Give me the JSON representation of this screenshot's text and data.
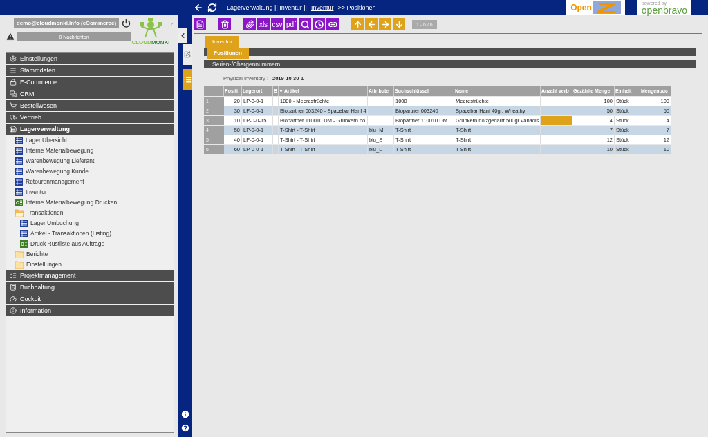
{
  "header": {
    "breadcrumb": [
      {
        "text": "Lagerverwaltung || Inventur ||",
        "link": false
      },
      {
        "text": "Inventur",
        "link": true
      },
      {
        "text": ">> Positionen",
        "link": false
      }
    ],
    "logos": {
      "openz": "Open",
      "powered_by": "powered by",
      "openbravo": "openbravo"
    }
  },
  "user": {
    "account": "demo@cloudmonki.info (eCommerce)",
    "messages": "0 Nachrichten",
    "logo_text": [
      "CLOUD",
      "MONKI"
    ]
  },
  "menu": [
    {
      "label": "Einstellungen",
      "expanded": false
    },
    {
      "label": "Stammdaten",
      "expanded": false
    },
    {
      "label": "E-Commerce",
      "expanded": false
    },
    {
      "label": "CRM",
      "expanded": false
    },
    {
      "label": "Bestellwesen",
      "expanded": false
    },
    {
      "label": "Vertrieb",
      "expanded": false
    },
    {
      "label": "Lagerverwaltung",
      "expanded": true,
      "children": [
        {
          "label": "Lager Übersicht",
          "kind": "window"
        },
        {
          "label": "Interne Materialbewegung",
          "kind": "window"
        },
        {
          "label": "Warenbewegung Lieferant",
          "kind": "window"
        },
        {
          "label": "Warenbewegung Kunde",
          "kind": "window"
        },
        {
          "label": "Retourenmanagement",
          "kind": "window"
        },
        {
          "label": "Inventur",
          "kind": "window"
        },
        {
          "label": "Interne Materialbewegung Drucken",
          "kind": "process"
        },
        {
          "label": "Transaktionen",
          "kind": "folder",
          "expanded": true,
          "children": [
            {
              "label": "Lager Umbuchung",
              "kind": "window"
            },
            {
              "label": "Artikel - Transaktionen (Listing)",
              "kind": "window"
            },
            {
              "label": "Druck Rüstliste aus Aufträge",
              "kind": "process"
            }
          ]
        },
        {
          "label": "Berichte",
          "kind": "folder",
          "expanded": false
        },
        {
          "label": "Einstellungen",
          "kind": "folder",
          "expanded": false
        }
      ]
    },
    {
      "label": "Projektmanagement",
      "expanded": false
    },
    {
      "label": "Buchhaltung",
      "expanded": false
    },
    {
      "label": "Cockpit",
      "expanded": false
    },
    {
      "label": "Information",
      "expanded": false
    }
  ],
  "side_tabs": [
    {
      "selected": false
    },
    {
      "selected": true
    }
  ],
  "toolbar": {
    "export_labels": [
      "xls",
      "csv",
      "pdf"
    ],
    "record_counter": "1 - 6 / 6"
  },
  "tabs": [
    {
      "label": "Inventur",
      "selected": false
    },
    {
      "label": "Positionen",
      "selected": true
    },
    {
      "label": "Serien-/Chargennummern",
      "selected": false
    }
  ],
  "header_field": {
    "label": "Physical Inventory :",
    "value": "2019-10-30-1"
  },
  "table": {
    "columns": [
      {
        "label": "Positi",
        "sorted": false
      },
      {
        "label": "Lagerort",
        "sorted": false
      },
      {
        "label": "B",
        "sorted": false
      },
      {
        "label": "Artikel",
        "sorted": true
      },
      {
        "label": "Attribute",
        "sorted": false
      },
      {
        "label": "Suchschlüssel",
        "sorted": false
      },
      {
        "label": "Name",
        "sorted": false
      },
      {
        "label": "Anzahl verb",
        "sorted": false
      },
      {
        "label": "Gezählte Menge",
        "sorted": false
      },
      {
        "label": "Einheit",
        "sorted": false
      },
      {
        "label": "Mengenbuc",
        "sorted": false
      }
    ],
    "rows": [
      {
        "num": "1",
        "flagged": false,
        "cells": [
          "20",
          "LP-0-0-1",
          null,
          "1000 - Meeresfrüchte",
          null,
          "1000",
          "Meeresfrüchte",
          null,
          "100",
          "Stück",
          "100"
        ]
      },
      {
        "num": "2",
        "flagged": false,
        "cells": [
          "30",
          "LP-0-0-1",
          null,
          "Biopartner 003240 - Spacebar Hanf 4",
          null,
          "Biopartner 003240",
          "Spacebar Hanf 40gr. Wheathy",
          null,
          "50",
          "Stück",
          "50"
        ]
      },
      {
        "num": "3",
        "flagged": true,
        "cells": [
          "10",
          "LP-0-0-15",
          null,
          "Biopartner 110010 DM - Grünkern ho",
          null,
          "Biopartner 110010 DM",
          "Grünkern holzgedarrt 500gr.Vanadis",
          null,
          "4",
          "Stück",
          "4"
        ]
      },
      {
        "num": "4",
        "flagged": false,
        "cells": [
          "50",
          "LP-0-0-1",
          null,
          "T-Shirt - T-Shirt",
          "blu_M",
          "T-Shirt",
          "T-Shirt",
          null,
          "7",
          "Stück",
          "7"
        ]
      },
      {
        "num": "5",
        "flagged": false,
        "cells": [
          "40",
          "LP-0-0-1",
          null,
          "T-Shirt - T-Shirt",
          "blu_S",
          "T-Shirt",
          "T-Shirt",
          null,
          "12",
          "Stück",
          "12"
        ]
      },
      {
        "num": "6",
        "flagged": false,
        "cells": [
          "60",
          "LP-0-0-1",
          null,
          "T-Shirt - T-Shirt",
          "blu_L",
          "T-Shirt",
          "T-Shirt",
          null,
          "10",
          "Stück",
          "10"
        ]
      }
    ]
  }
}
